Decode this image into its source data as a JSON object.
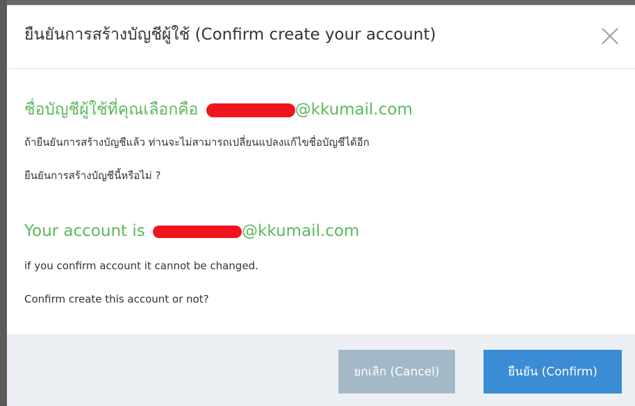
{
  "header": {
    "title": "ยืนยันการสร้างบัญชีผู้ใช้ (Confirm create your account)",
    "close_icon": "close-icon"
  },
  "body": {
    "thai": {
      "account_prefix": "ชื่อบัญชีผู้ใช้ที่คุณเลือกคือ",
      "email_suffix": "@kkumail.com",
      "warning": "ถ้ายืนยันการสร้างบัญชีแล้ว ท่านจะไม่สามารถเปลี่ยนแปลงแก้ไขชื่อบัญชีได้อีก",
      "question": "ยืนยันการสร้างบัญชีนี้หรือไม่ ?"
    },
    "english": {
      "account_prefix": "Your account is",
      "email_suffix": "@kkumail.com",
      "warning": "if you confirm account it cannot be changed.",
      "question": "Confirm create this account or not?"
    }
  },
  "footer": {
    "cancel_label": "ยกเลิก (Cancel)",
    "confirm_label": "ยืนยัน (Confirm)"
  },
  "colors": {
    "green": "#5cb85c",
    "cancel_bg": "#a3b9c8",
    "confirm_bg": "#3a8dd4",
    "redaction": "#f0141e"
  }
}
